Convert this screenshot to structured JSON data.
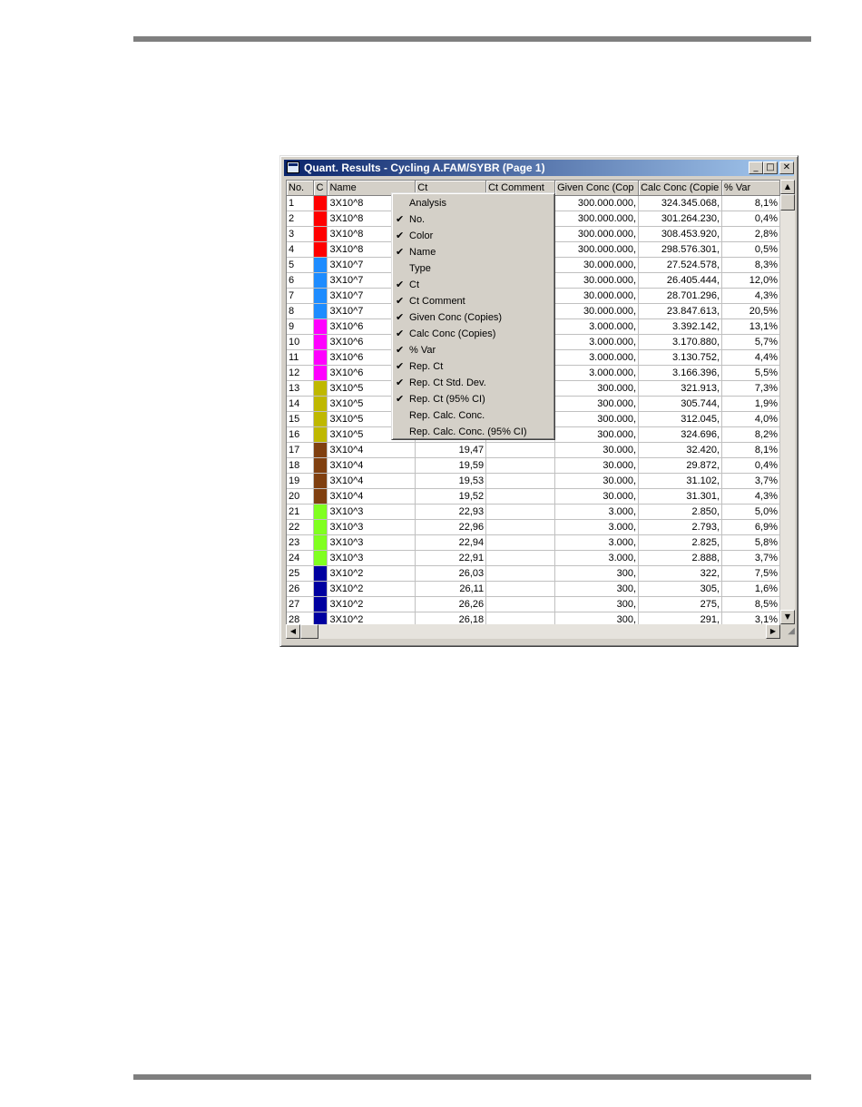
{
  "window": {
    "title": "Quant. Results - Cycling A.FAM/SYBR (Page 1)",
    "buttons": {
      "minimize": "_",
      "maximize": "□",
      "close": "✕"
    }
  },
  "table": {
    "columns": [
      "No.",
      "C",
      "Name",
      "Ct",
      "Ct Comment",
      "Given Conc (Cop",
      "Calc Conc (Copie",
      "% Var"
    ],
    "rows": [
      {
        "no": "1",
        "color": "#ff0000",
        "name": "3X10^8",
        "ct": "",
        "comment": "",
        "given": "300.000.000,",
        "calc": "324.345.068,",
        "var": "8,1%"
      },
      {
        "no": "2",
        "color": "#ff0000",
        "name": "3X10^8",
        "ct": "",
        "comment": "",
        "given": "300.000.000,",
        "calc": "301.264.230,",
        "var": "0,4%"
      },
      {
        "no": "3",
        "color": "#ff0000",
        "name": "3X10^8",
        "ct": "",
        "comment": "",
        "given": "300.000.000,",
        "calc": "308.453.920,",
        "var": "2,8%"
      },
      {
        "no": "4",
        "color": "#ff0000",
        "name": "3X10^8",
        "ct": "",
        "comment": "",
        "given": "300.000.000,",
        "calc": "298.576.301,",
        "var": "0,5%"
      },
      {
        "no": "5",
        "color": "#1e8cff",
        "name": "3X10^7",
        "ct": "",
        "comment": "",
        "given": "30.000.000,",
        "calc": "27.524.578,",
        "var": "8,3%"
      },
      {
        "no": "6",
        "color": "#1e8cff",
        "name": "3X10^7",
        "ct": "",
        "comment": "",
        "given": "30.000.000,",
        "calc": "26.405.444,",
        "var": "12,0%"
      },
      {
        "no": "7",
        "color": "#1e8cff",
        "name": "3X10^7",
        "ct": "",
        "comment": "",
        "given": "30.000.000,",
        "calc": "28.701.296,",
        "var": "4,3%"
      },
      {
        "no": "8",
        "color": "#1e8cff",
        "name": "3X10^7",
        "ct": "",
        "comment": "",
        "given": "30.000.000,",
        "calc": "23.847.613,",
        "var": "20,5%"
      },
      {
        "no": "9",
        "color": "#ff00ff",
        "name": "3X10^6",
        "ct": "",
        "comment": "",
        "given": "3.000.000,",
        "calc": "3.392.142,",
        "var": "13,1%"
      },
      {
        "no": "10",
        "color": "#ff00ff",
        "name": "3X10^6",
        "ct": "",
        "comment": "",
        "given": "3.000.000,",
        "calc": "3.170.880,",
        "var": "5,7%"
      },
      {
        "no": "11",
        "color": "#ff00ff",
        "name": "3X10^6",
        "ct": "",
        "comment": "",
        "given": "3.000.000,",
        "calc": "3.130.752,",
        "var": "4,4%"
      },
      {
        "no": "12",
        "color": "#ff00ff",
        "name": "3X10^6",
        "ct": "",
        "comment": "",
        "given": "3.000.000,",
        "calc": "3.166.396,",
        "var": "5,5%"
      },
      {
        "no": "13",
        "color": "#bfb800",
        "name": "3X10^5",
        "ct": "",
        "comment": "",
        "given": "300.000,",
        "calc": "321.913,",
        "var": "7,3%"
      },
      {
        "no": "14",
        "color": "#bfb800",
        "name": "3X10^5",
        "ct": "",
        "comment": "",
        "given": "300.000,",
        "calc": "305.744,",
        "var": "1,9%"
      },
      {
        "no": "15",
        "color": "#bfb800",
        "name": "3X10^5",
        "ct": "",
        "comment": "",
        "given": "300.000,",
        "calc": "312.045,",
        "var": "4,0%"
      },
      {
        "no": "16",
        "color": "#bfb800",
        "name": "3X10^5",
        "ct": "",
        "comment": "",
        "given": "300.000,",
        "calc": "324.696,",
        "var": "8,2%"
      },
      {
        "no": "17",
        "color": "#804010",
        "name": "3X10^4",
        "ct": "19,47",
        "comment": "",
        "given": "30.000,",
        "calc": "32.420,",
        "var": "8,1%"
      },
      {
        "no": "18",
        "color": "#804010",
        "name": "3X10^4",
        "ct": "19,59",
        "comment": "",
        "given": "30.000,",
        "calc": "29.872,",
        "var": "0,4%"
      },
      {
        "no": "19",
        "color": "#804010",
        "name": "3X10^4",
        "ct": "19,53",
        "comment": "",
        "given": "30.000,",
        "calc": "31.102,",
        "var": "3,7%"
      },
      {
        "no": "20",
        "color": "#804010",
        "name": "3X10^4",
        "ct": "19,52",
        "comment": "",
        "given": "30.000,",
        "calc": "31.301,",
        "var": "4,3%"
      },
      {
        "no": "21",
        "color": "#80ff20",
        "name": "3X10^3",
        "ct": "22,93",
        "comment": "",
        "given": "3.000,",
        "calc": "2.850,",
        "var": "5,0%"
      },
      {
        "no": "22",
        "color": "#80ff20",
        "name": "3X10^3",
        "ct": "22,96",
        "comment": "",
        "given": "3.000,",
        "calc": "2.793,",
        "var": "6,9%"
      },
      {
        "no": "23",
        "color": "#80ff20",
        "name": "3X10^3",
        "ct": "22,94",
        "comment": "",
        "given": "3.000,",
        "calc": "2.825,",
        "var": "5,8%"
      },
      {
        "no": "24",
        "color": "#80ff20",
        "name": "3X10^3",
        "ct": "22,91",
        "comment": "",
        "given": "3.000,",
        "calc": "2.888,",
        "var": "3,7%"
      },
      {
        "no": "25",
        "color": "#0000a0",
        "name": "3X10^2",
        "ct": "26,03",
        "comment": "",
        "given": "300,",
        "calc": "322,",
        "var": "7,5%"
      },
      {
        "no": "26",
        "color": "#0000a0",
        "name": "3X10^2",
        "ct": "26,11",
        "comment": "",
        "given": "300,",
        "calc": "305,",
        "var": "1,6%"
      },
      {
        "no": "27",
        "color": "#0000a0",
        "name": "3X10^2",
        "ct": "26,26",
        "comment": "",
        "given": "300,",
        "calc": "275,",
        "var": "8,5%"
      },
      {
        "no": "28",
        "color": "#0000a0",
        "name": "3X10^2",
        "ct": "26,18",
        "comment": "",
        "given": "300,",
        "calc": "291,",
        "var": "3,1%"
      }
    ]
  },
  "context_menu": {
    "items": [
      {
        "label": "Analysis",
        "checked": false
      },
      {
        "label": "No.",
        "checked": true
      },
      {
        "label": "Color",
        "checked": true
      },
      {
        "label": "Name",
        "checked": true
      },
      {
        "label": "Type",
        "checked": false
      },
      {
        "label": "Ct",
        "checked": true
      },
      {
        "label": "Ct Comment",
        "checked": true
      },
      {
        "label": "Given Conc (Copies)",
        "checked": true
      },
      {
        "label": "Calc Conc (Copies)",
        "checked": true
      },
      {
        "label": "% Var",
        "checked": true
      },
      {
        "label": "Rep. Ct",
        "checked": true
      },
      {
        "label": "Rep. Ct Std. Dev.",
        "checked": true
      },
      {
        "label": "Rep. Ct (95% CI)",
        "checked": true
      },
      {
        "label": "Rep. Calc. Conc.",
        "checked": false
      },
      {
        "label": "Rep. Calc. Conc. (95% CI)",
        "checked": false
      }
    ],
    "check_glyph": "✔"
  },
  "scrollbars": {
    "up": "▲",
    "down": "▼",
    "left": "◀",
    "right": "▶",
    "grip": "◢"
  }
}
